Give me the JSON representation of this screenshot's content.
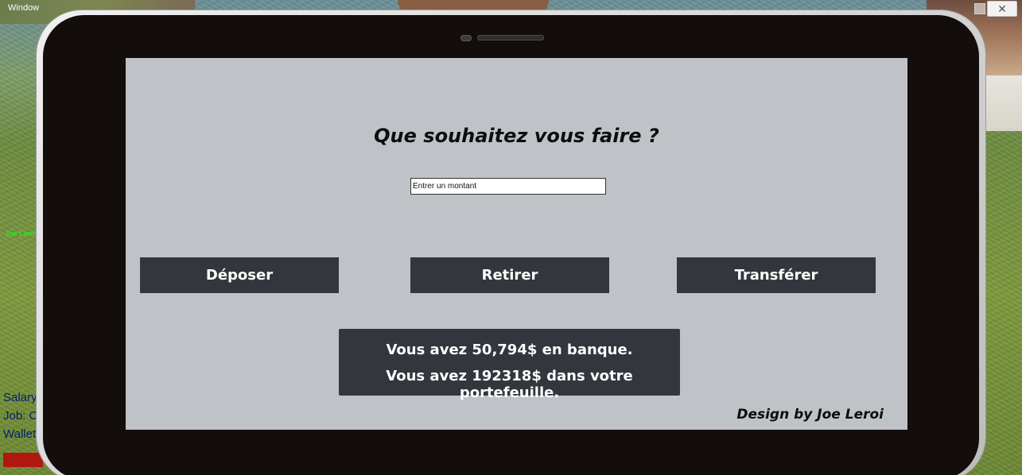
{
  "window": {
    "title": "Window",
    "close_glyph": "✕"
  },
  "hud": {
    "player_name": "Joe Leroi",
    "lines": [
      "Salary",
      "Job: C",
      "Wallet"
    ]
  },
  "screen": {
    "title": "Que souhaitez vous faire ?",
    "amount_input": {
      "placeholder": "Entrer un montant",
      "value": ""
    },
    "buttons": {
      "deposit": "Déposer",
      "withdraw": "Retirer",
      "transfer": "Transférer"
    },
    "balance": {
      "bank_line": "Vous avez 50,794$ en banque.",
      "wallet_line": "Vous avez 192318$ dans votre portefeuille."
    },
    "credits": "Design by Joe Leroi"
  },
  "icons": {
    "camera": "camera-icon",
    "speaker": "speaker-icon",
    "maximize": "maximize-icon",
    "close": "close-icon"
  },
  "colors": {
    "screen_bg": "#bfc3c7",
    "button_bg": "#33363c",
    "tablet_bezel": "#130d0b",
    "hud_name": "#1cf01c",
    "hud_text": "#00206e"
  }
}
